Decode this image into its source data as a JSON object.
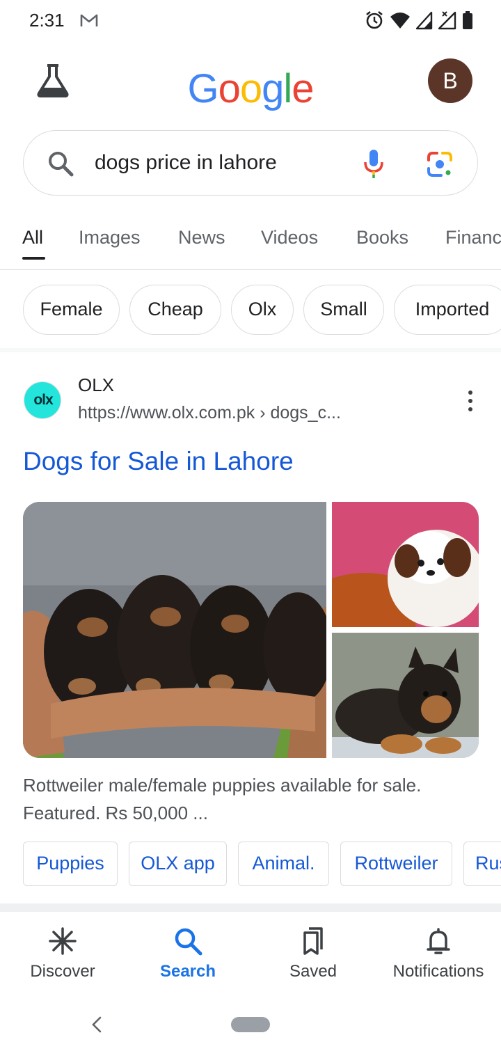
{
  "status_bar": {
    "time": "2:31"
  },
  "header": {
    "logo_letters": [
      {
        "char": "G",
        "color": "#4285F4"
      },
      {
        "char": "o",
        "color": "#EA4335"
      },
      {
        "char": "o",
        "color": "#FBBC05"
      },
      {
        "char": "g",
        "color": "#4285F4"
      },
      {
        "char": "l",
        "color": "#34A853"
      },
      {
        "char": "e",
        "color": "#EA4335"
      }
    ],
    "avatar_initial": "B",
    "avatar_color": "#5b3528"
  },
  "search": {
    "query": "dogs price in lahore"
  },
  "tabs": [
    {
      "label": "All",
      "active": true
    },
    {
      "label": "Images",
      "active": false
    },
    {
      "label": "News",
      "active": false
    },
    {
      "label": "Videos",
      "active": false
    },
    {
      "label": "Books",
      "active": false
    },
    {
      "label": "Finance",
      "active": false
    }
  ],
  "chips": [
    "Female",
    "Cheap",
    "Olx",
    "Small",
    "Imported"
  ],
  "result": {
    "favicon_text": "olx",
    "site_name": "OLX",
    "url": "https://www.olx.com.pk › dogs_c...",
    "title": "Dogs for Sale in Lahore",
    "images": [
      {
        "alt": "Rottweiler puppies held in arms",
        "icon": "photo"
      },
      {
        "alt": "Shih Tzu puppy",
        "icon": "photo"
      },
      {
        "alt": "German Shepherd puppy",
        "icon": "photo"
      }
    ],
    "snippet": "Rottweiler male/female puppies available for sale. Featured. Rs 50,000 ...",
    "related": [
      "Puppies",
      "OLX app",
      "Animal.",
      "Rottweiler",
      "Rus"
    ]
  },
  "bottom_nav": [
    {
      "label": "Discover",
      "icon": "asterisk-icon",
      "active": false
    },
    {
      "label": "Search",
      "icon": "search-icon",
      "active": true
    },
    {
      "label": "Saved",
      "icon": "bookmarks-icon",
      "active": false
    },
    {
      "label": "Notifications",
      "icon": "bell-icon",
      "active": false
    }
  ],
  "colors": {
    "link": "#1558d6",
    "active_nav": "#1a73e8",
    "olx_teal": "#23e5db"
  }
}
